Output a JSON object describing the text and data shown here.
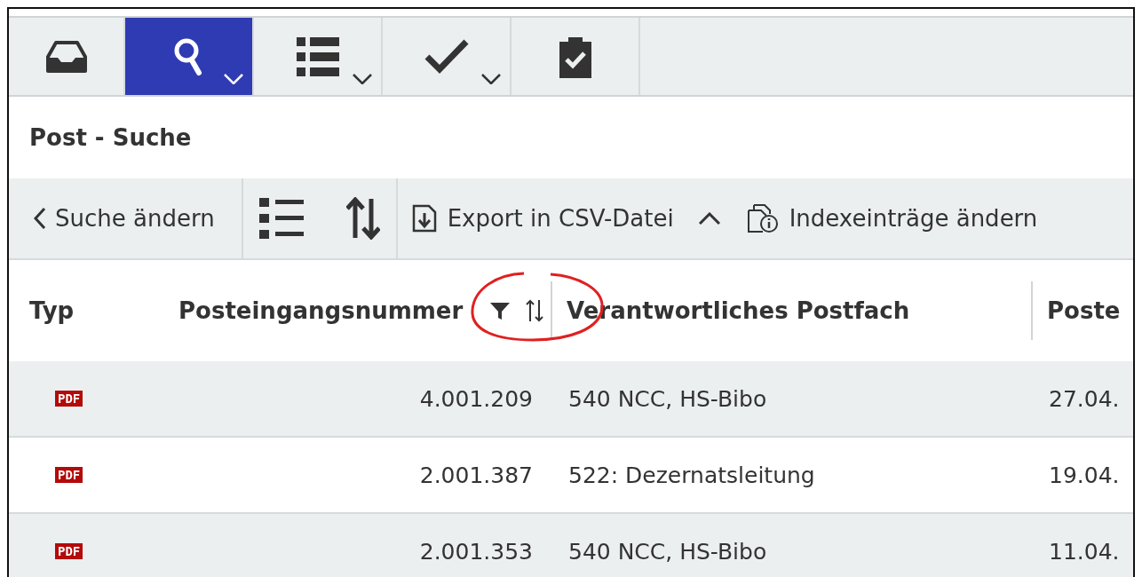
{
  "toolbar": {
    "buttons": [
      {
        "kind": "inbox",
        "dropdown": false,
        "selected": false
      },
      {
        "kind": "search",
        "dropdown": true,
        "selected": true
      },
      {
        "kind": "list",
        "dropdown": true,
        "selected": false
      },
      {
        "kind": "check",
        "dropdown": true,
        "selected": false
      },
      {
        "kind": "clipboard",
        "dropdown": false,
        "selected": false
      }
    ]
  },
  "page_title": "Post - Suche",
  "action_bar": {
    "groups": [
      [
        {
          "kind": "back",
          "label": "Suche ändern"
        }
      ],
      [
        {
          "kind": "list"
        },
        {
          "kind": "sort"
        }
      ],
      [
        {
          "kind": "export",
          "label": "Export in CSV-Datei"
        },
        {
          "kind": "collapse"
        },
        {
          "kind": "index",
          "label": "Indexeinträge ändern"
        }
      ]
    ]
  },
  "table": {
    "columns": [
      {
        "label": "Typ",
        "filter_icon": false,
        "sort_icon": false
      },
      {
        "label": "Posteingangsnummer",
        "filter_icon": true,
        "sort_icon": true
      },
      {
        "label": "Verantwortliches Postfach",
        "filter_icon": false,
        "sort_icon": false
      },
      {
        "label": "Poste",
        "filter_icon": false,
        "sort_icon": false
      }
    ],
    "rows": [
      {
        "cells": [
          "PDF",
          "4.001.209",
          "540 NCC, HS-Bibo",
          "27.04."
        ]
      },
      {
        "cells": [
          "PDF",
          "2.001.387",
          "522: Dezernatsleitung",
          "19.04."
        ]
      },
      {
        "cells": [
          "PDF",
          "2.001.353",
          "540 NCC, HS-Bibo",
          "11.04."
        ]
      }
    ]
  }
}
